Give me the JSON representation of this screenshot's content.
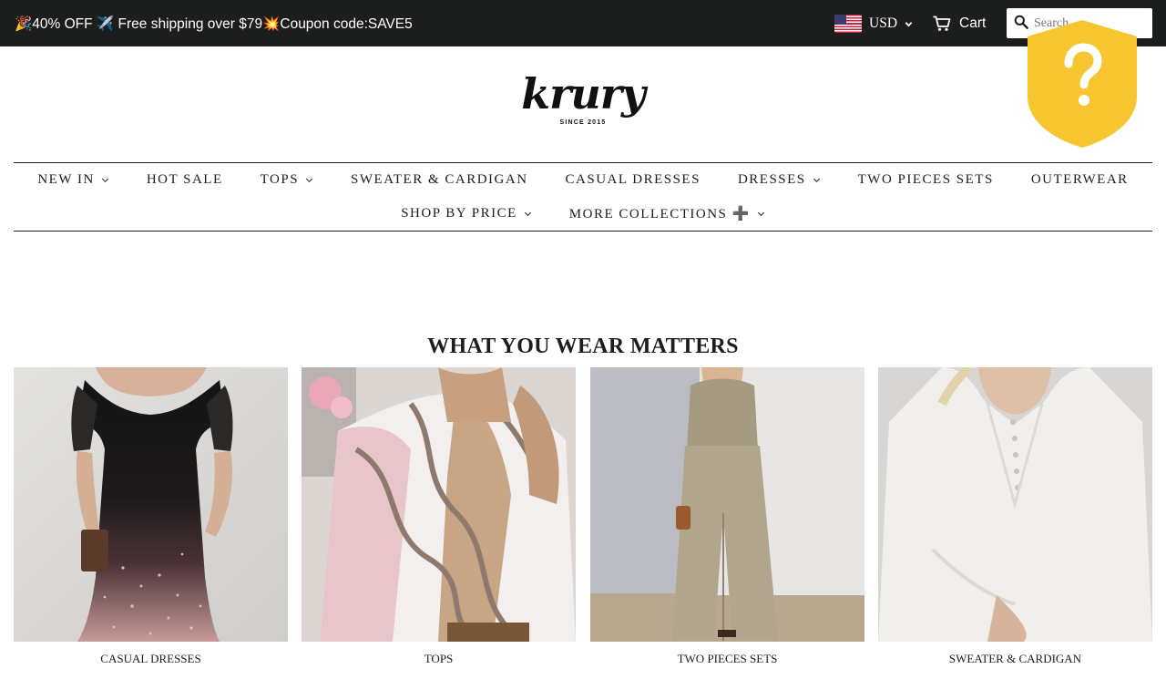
{
  "announcement": {
    "text": "🎉40% OFF ✈️ Free shipping over $79💥Coupon code:SAVE5"
  },
  "header": {
    "currency": "USD",
    "cart_label": "Cart",
    "search_placeholder": "Search"
  },
  "brand": {
    "name": "krury",
    "tagline": "SINCE 2015"
  },
  "nav": {
    "row1": [
      {
        "label": "NEW IN",
        "dropdown": true
      },
      {
        "label": "HOT SALE",
        "dropdown": false
      },
      {
        "label": "TOPS",
        "dropdown": true
      },
      {
        "label": "SWEATER & CARDIGAN",
        "dropdown": false
      },
      {
        "label": "CASUAL DRESSES",
        "dropdown": false
      },
      {
        "label": "DRESSES",
        "dropdown": true
      },
      {
        "label": "TWO PIECES SETS",
        "dropdown": false
      },
      {
        "label": "OUTERWEAR",
        "dropdown": false
      }
    ],
    "row2": [
      {
        "label": "SHOP BY PRICE",
        "dropdown": true
      },
      {
        "label": "MORE COLLECTIONS ➕",
        "dropdown": true
      }
    ]
  },
  "featured": {
    "title": "WHAT YOU WEAR MATTERS",
    "collections": [
      {
        "label": "CASUAL DRESSES"
      },
      {
        "label": "TOPS"
      },
      {
        "label": "TWO PIECES SETS"
      },
      {
        "label": "SWEATER & CARDIGAN"
      }
    ]
  },
  "colors": {
    "topbar_bg": "#1c1d1d",
    "shield": "#f7c52f",
    "text": "#1c1d1d"
  },
  "icons": {
    "shield_badge": "question-shield-icon",
    "cart": "cart-icon",
    "search": "search-icon",
    "flag": "us-flag-icon"
  }
}
